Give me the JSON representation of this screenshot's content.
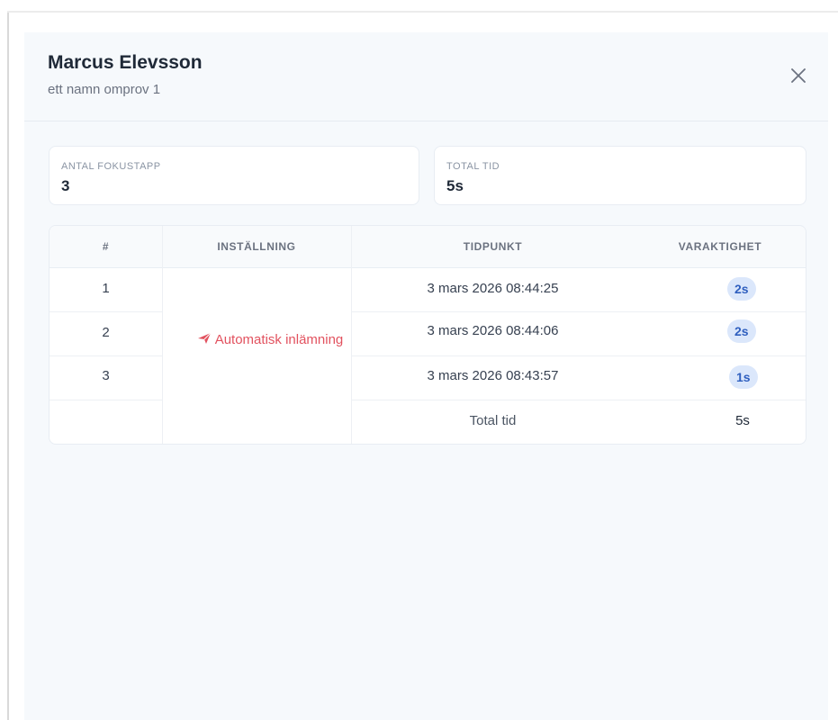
{
  "header": {
    "title": "Marcus Elevsson",
    "subtitle": "ett namn omprov 1"
  },
  "stats": {
    "focus_loss_label": "ANTAL FOKUSTAPP",
    "focus_loss_value": "3",
    "total_time_label": "TOTAL TID",
    "total_time_value": "5s"
  },
  "table": {
    "headers": {
      "number": "#",
      "setting": "INSTÄLLNING",
      "timestamp": "TIDPUNKT",
      "duration": "VARAKTIGHET"
    },
    "setting_value": "Automatisk inlämning",
    "setting_icon": "send-icon",
    "rows": [
      {
        "number": "1",
        "timestamp": "3 mars 2026 08:44:25",
        "duration": "2s"
      },
      {
        "number": "2",
        "timestamp": "3 mars 2026 08:44:06",
        "duration": "2s"
      },
      {
        "number": "3",
        "timestamp": "3 mars 2026 08:43:57",
        "duration": "1s"
      }
    ],
    "footer": {
      "label": "Total tid",
      "value": "5s"
    }
  },
  "colors": {
    "accent_badge_bg": "#dbe7fb",
    "accent_badge_text": "#2f5fbf",
    "setting_red": "#e2525f"
  }
}
